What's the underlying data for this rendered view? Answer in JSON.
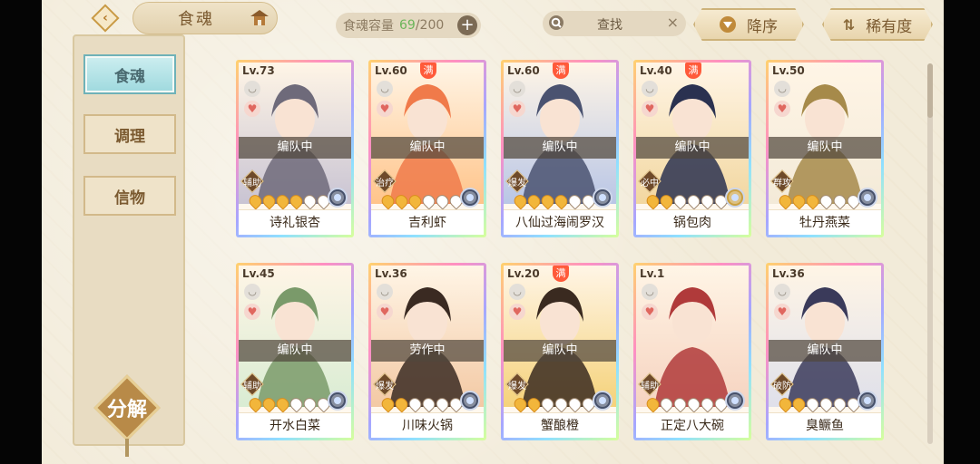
{
  "header": {
    "title": "食魂",
    "capacity_label": "食魂容量",
    "capacity_current": "69",
    "capacity_sep": "/",
    "capacity_max": "200",
    "plus": "+",
    "search_text": "查找",
    "search_clear": "×",
    "sort_desc_label": "降序",
    "sort_rarity_label": "稀有度"
  },
  "sidebar": {
    "tabs": [
      {
        "label": "食魂",
        "active": true
      },
      {
        "label": "调理",
        "active": false
      },
      {
        "label": "信物",
        "active": false
      }
    ],
    "decompose_label": "分解"
  },
  "cards": [
    {
      "level": "Lv.73",
      "full": "",
      "team": "编队中",
      "role": "辅助",
      "stars_filled": 4,
      "name": "诗礼银杏"
    },
    {
      "level": "Lv.60",
      "full": "满",
      "team": "编队中",
      "role": "治疗",
      "stars_filled": 3,
      "name": "吉利虾"
    },
    {
      "level": "Lv.60",
      "full": "满",
      "team": "编队中",
      "role": "爆发",
      "stars_filled": 4,
      "name": "八仙过海闹罗汉"
    },
    {
      "level": "Lv.40",
      "full": "满",
      "team": "编队中",
      "role": "必中",
      "stars_filled": 2,
      "name": "锅包肉"
    },
    {
      "level": "Lv.50",
      "full": "",
      "team": "编队中",
      "role": "群攻",
      "stars_filled": 3,
      "name": "牡丹燕菜"
    },
    {
      "level": "Lv.45",
      "full": "",
      "team": "编队中",
      "role": "辅助",
      "stars_filled": 3,
      "name": "开水白菜"
    },
    {
      "level": "Lv.36",
      "full": "",
      "team": "劳作中",
      "role": "爆发",
      "stars_filled": 2,
      "name": "川味火锅"
    },
    {
      "level": "Lv.20",
      "full": "满",
      "team": "编队中",
      "role": "爆发",
      "stars_filled": 2,
      "name": "蟹酿橙"
    },
    {
      "level": "Lv.1",
      "full": "",
      "team": "",
      "role": "辅助",
      "stars_filled": 1,
      "name": "正定八大碗"
    },
    {
      "level": "Lv.36",
      "full": "",
      "team": "编队中",
      "role": "破防",
      "stars_filled": 2,
      "name": "臭鳜鱼"
    }
  ],
  "icons": {
    "back": "back-arrow-icon",
    "home": "house-icon",
    "search": "search-icon",
    "sort": "triangle-down-icon",
    "swap": "swap-icon",
    "heart": "heart-icon",
    "cup": "bowl-icon",
    "element": "element-icon"
  },
  "colors": {
    "accent_green": "#6cb55a",
    "badge_full": "#ff5a3a",
    "panel_bg": "#f2ebd9",
    "tab_active": "#9ed9de"
  }
}
